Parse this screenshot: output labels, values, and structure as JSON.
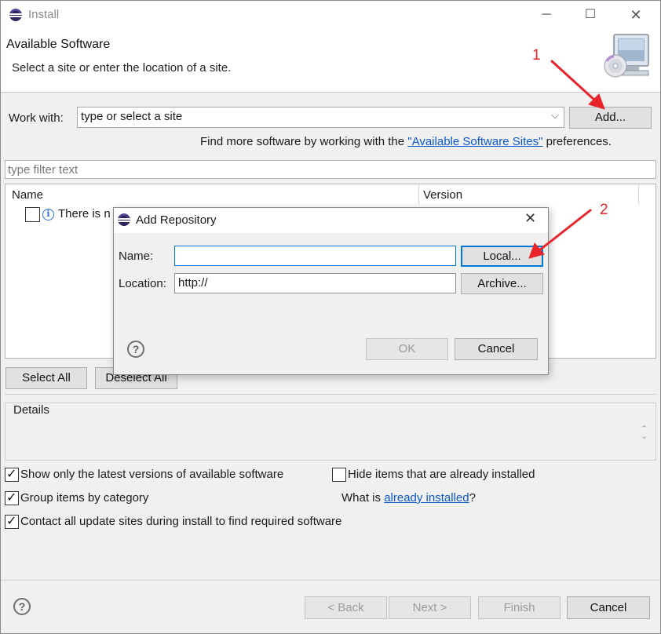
{
  "window": {
    "title": "Install",
    "minimize_icon": "minimize-icon",
    "maximize_icon": "maximize-icon",
    "close_icon": "close-icon"
  },
  "header": {
    "title": "Available Software",
    "subtitle": "Select a site or enter the location of a site."
  },
  "work_with": {
    "label": "Work with:",
    "value": "type or select a site",
    "add_button": "Add...",
    "hint_prefix": "Find more software by working with the ",
    "hint_link": "\"Available Software Sites\"",
    "hint_suffix": " preferences."
  },
  "filter": {
    "placeholder": "type filter text"
  },
  "table": {
    "columns": [
      "Name",
      "Version"
    ],
    "rows": [
      {
        "text": "There is n"
      }
    ]
  },
  "selection_buttons": {
    "select_all": "Select All",
    "deselect_all": "Deselect All"
  },
  "details": {
    "label": "Details"
  },
  "options": {
    "show_latest": {
      "label": "Show only the latest versions of available software",
      "checked": true
    },
    "hide_installed": {
      "label": "Hide items that are already installed",
      "checked": false
    },
    "group_by_category": {
      "label": "Group items by category",
      "checked": true
    },
    "contact_all": {
      "label": "Contact all update sites during install to find required software",
      "checked": true
    },
    "what_is_prefix": "What is ",
    "what_is_link": "already installed",
    "what_is_suffix": "?"
  },
  "footer": {
    "back": "< Back",
    "next": "Next >",
    "finish": "Finish",
    "cancel": "Cancel"
  },
  "dialog": {
    "title": "Add Repository",
    "name_label": "Name:",
    "name_value": "",
    "location_label": "Location:",
    "location_value": "http://",
    "local_button": "Local...",
    "archive_button": "Archive...",
    "ok_button": "OK",
    "cancel_button": "Cancel"
  },
  "annotations": {
    "marker_1": "1",
    "marker_2": "2",
    "color": "#e8232a"
  }
}
